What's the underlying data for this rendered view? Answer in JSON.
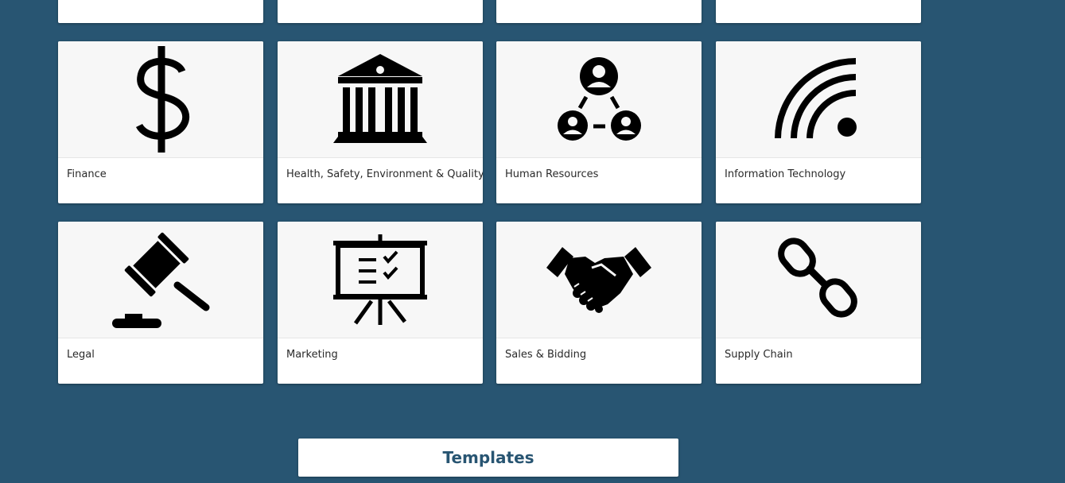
{
  "colors": {
    "background": "#285572",
    "card": "#ffffff",
    "thumb": "#f7f7f7",
    "icon": "#000000",
    "accent_text": "#285572"
  },
  "top_row": [
    {
      "label": ""
    },
    {
      "label": ""
    },
    {
      "label": ""
    },
    {
      "label": ""
    }
  ],
  "cards": [
    {
      "label": "Finance",
      "icon": "dollar-sign-icon"
    },
    {
      "label": "Health, Safety, Environment & Quality",
      "icon": "government-building-icon"
    },
    {
      "label": "Human Resources",
      "icon": "people-network-icon"
    },
    {
      "label": "Information Technology",
      "icon": "signal-arcs-icon"
    },
    {
      "label": "Legal",
      "icon": "gavel-icon"
    },
    {
      "label": "Marketing",
      "icon": "presentation-board-icon"
    },
    {
      "label": "Sales & Bidding",
      "icon": "handshake-icon"
    },
    {
      "label": "Supply Chain",
      "icon": "chain-link-icon"
    }
  ],
  "templates_button": {
    "label": "Templates"
  }
}
